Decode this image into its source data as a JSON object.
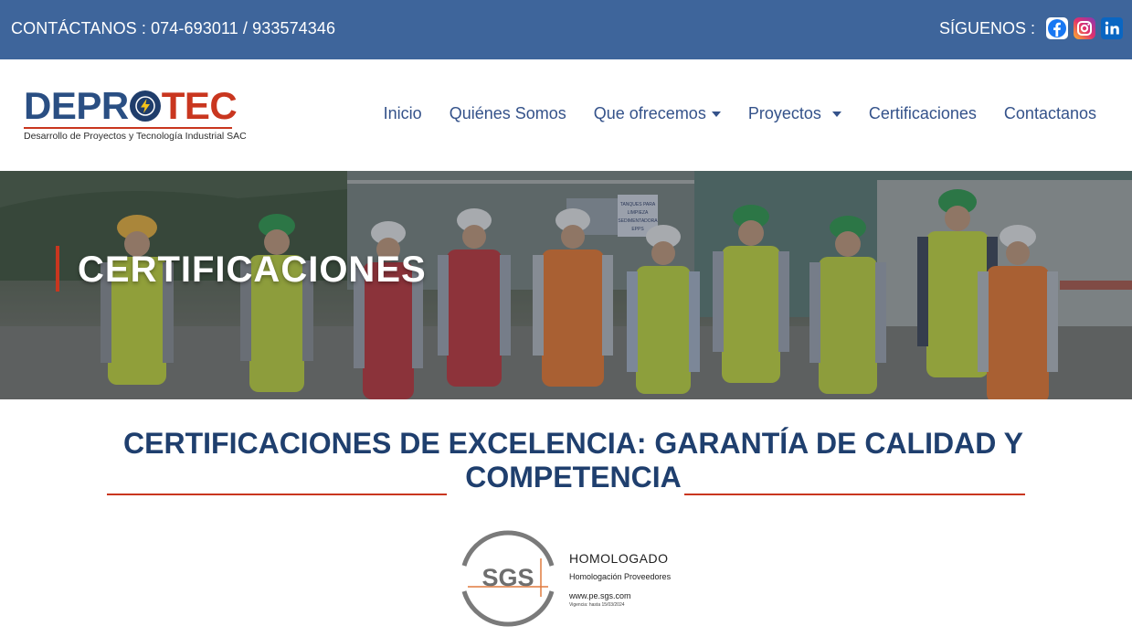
{
  "topbar": {
    "contact_text": "CONTÁCTANOS : 074-693011 / 933574346",
    "follow_label": "SÍGUENOS :",
    "social_icons": [
      "facebook-icon",
      "instagram-icon",
      "linkedin-icon"
    ]
  },
  "brand": {
    "name_part1": "DEPR",
    "name_part2": "TEC",
    "tagline": "Desarrollo de Proyectos y Tecnología Industrial SAC",
    "colors": {
      "blue": "#2a4f83",
      "red": "#c9361f"
    }
  },
  "nav": {
    "items": [
      {
        "label": "Inicio",
        "dropdown": false
      },
      {
        "label": "Quiénes Somos",
        "dropdown": false
      },
      {
        "label": "Que ofrecemos",
        "dropdown": true
      },
      {
        "label": "Proyectos",
        "dropdown": true
      },
      {
        "label": "Certificaciones",
        "dropdown": false
      },
      {
        "label": "Contactanos",
        "dropdown": false
      }
    ]
  },
  "hero": {
    "title": "CERTIFICACIONES",
    "sign_text": "TANQUES PARA LIMPIEZA SEDIMENTADORA EPPS"
  },
  "section": {
    "title": "CERTIFICACIONES DE EXCELENCIA: GARANTÍA DE CALIDAD Y COMPETENCIA"
  },
  "certificate": {
    "logo_text": "SGS",
    "status": "HOMOLOGADO",
    "subtitle": "Homologación Proveedores",
    "website": "www.pe.sgs.com",
    "validity": "Vigencia: hasta 15/03/2024"
  },
  "theme": {
    "topbar_bg": "#3e659b",
    "nav_text": "#34528a",
    "heading_text": "#1f3f6e",
    "accent_red": "#c9361f"
  }
}
